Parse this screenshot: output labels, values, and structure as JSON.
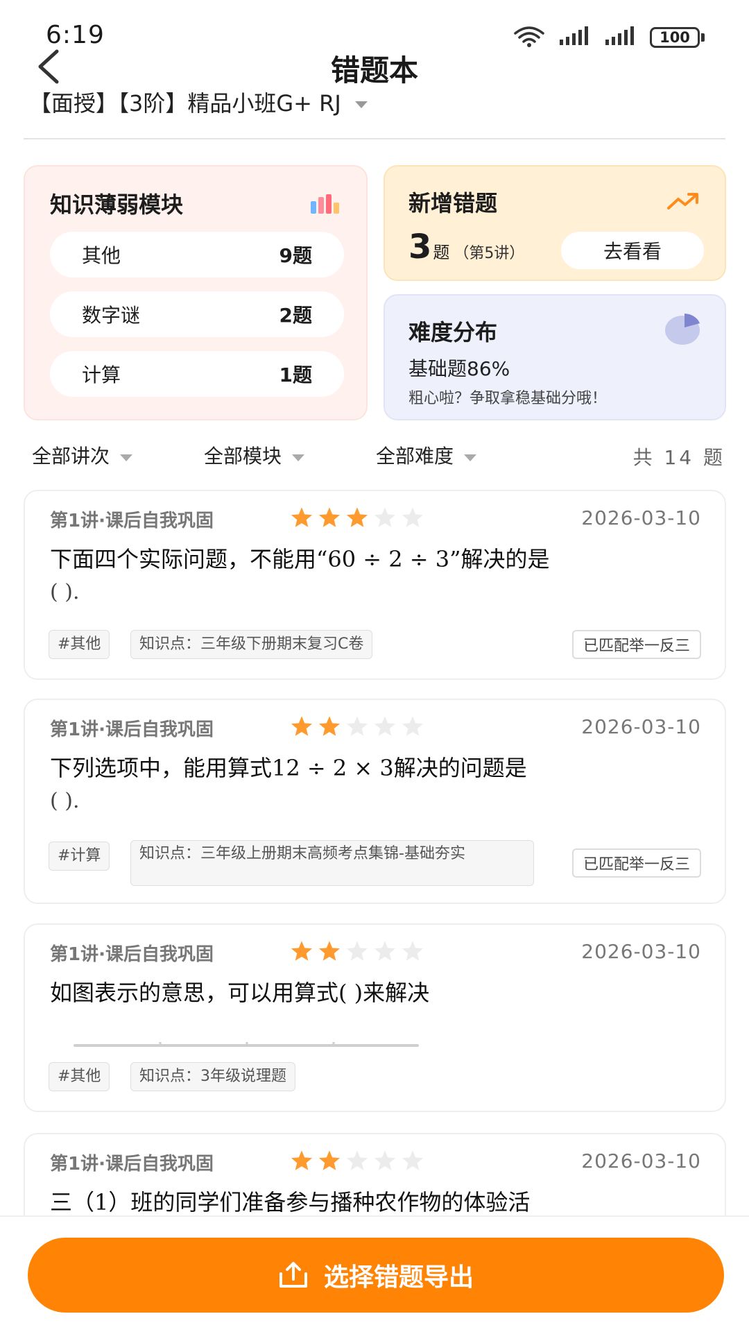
{
  "status_bar": {
    "time": "6:19",
    "battery": "100"
  },
  "header": {
    "title": "错题本",
    "class_name": "【面授】【3阶】精品小班G+ RJ"
  },
  "weak_modules": {
    "title": "知识薄弱模块",
    "items": [
      {
        "name": "其他",
        "count": "9题"
      },
      {
        "name": "数字谜",
        "count": "2题"
      },
      {
        "name": "计算",
        "count": "1题"
      }
    ]
  },
  "new_errors": {
    "title": "新增错题",
    "count": "3",
    "unit": "题",
    "lecture": "（第5讲）",
    "button": "去看看"
  },
  "difficulty": {
    "title": "难度分布",
    "stat": "基础题86%",
    "note": "粗心啦？争取拿稳基础分哦！"
  },
  "filters": {
    "lecture": "全部讲次",
    "module": "全部模块",
    "difficulty": "全部难度",
    "total": "共 14 题"
  },
  "questions": [
    {
      "lesson": "第1讲·课后自我巩固",
      "stars": 3,
      "date": "2026-03-10",
      "text": "下面四个实际问题，不能用“60 ÷ 2 ÷ 3”解决的是",
      "blank": "(            ).",
      "category_tag": "#其他",
      "knowledge_tag": "知识点：三年级下册期末复习C卷",
      "match": "已匹配举一反三"
    },
    {
      "lesson": "第1讲·课后自我巩固",
      "stars": 2,
      "date": "2026-03-10",
      "text": "下列选项中，能用算式12 ÷ 2 × 3解决的问题是",
      "blank": "(            ).",
      "category_tag": "#计算",
      "knowledge_tag": "知识点：三年级上册期末高频考点集锦-基础夯实",
      "match": "已匹配举一反三"
    },
    {
      "lesson": "第1讲·课后自我巩固",
      "stars": 2,
      "date": "2026-03-10",
      "text": "如图表示的意思，可以用算式(            )来解决",
      "category_tag": "#其他",
      "knowledge_tag": "知识点：3年级说理题"
    },
    {
      "lesson": "第1讲·课后自我巩固",
      "stars": 2,
      "date": "2026-03-10",
      "text": "三（1）班的同学们准备参与播种农作物的体验活"
    }
  ],
  "export_button": "选择错题导出",
  "colors": {
    "accent": "#ff8304",
    "star_filled": "#ff9a2e",
    "star_empty": "#ececec"
  }
}
